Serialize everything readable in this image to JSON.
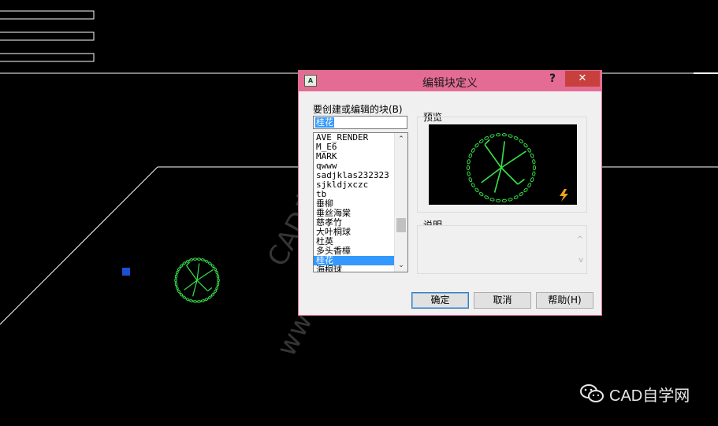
{
  "dialog": {
    "title": "编辑块定义",
    "help_glyph": "?",
    "close_glyph": "✕",
    "app_icon_text": "A",
    "block_label": "要创建或编辑的块(B)",
    "block_name_value": "桂花",
    "blocks": [
      "AVE_RENDER",
      "M_E6",
      "MARK",
      "qwww",
      "sadjklas232323",
      "sjkldjxczc",
      "tb",
      "垂柳",
      "垂丝海棠",
      "慈孝竹",
      "大叶桐球",
      "杜英",
      "多头香樟",
      "桂花",
      "海桐球"
    ],
    "selected_block": "桂花",
    "preview_label": "预览",
    "description_label": "说明",
    "ok_label": "确定",
    "cancel_label": "取消",
    "help_label": "帮助(H)"
  },
  "scrollbar": {
    "up_glyph": "⌃",
    "down_glyph": "⌄"
  },
  "description_scroll": {
    "up_glyph": "^",
    "down_glyph": "v"
  },
  "watermarks": {
    "top": "CAD自学网",
    "bottom": "www.cadzxw.com"
  },
  "logo": {
    "text": "CAD自学网",
    "icon": "wechat-icon"
  },
  "colors": {
    "title_bar": "#e46c94",
    "close_button": "#c7403d",
    "selection": "#3399ff",
    "cad_green": "#36e24a",
    "canvas": "#000000"
  }
}
